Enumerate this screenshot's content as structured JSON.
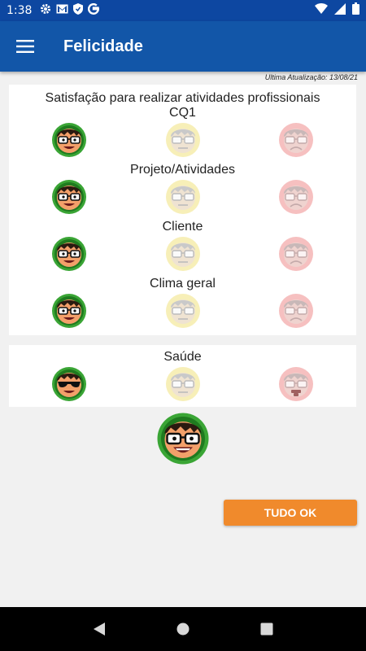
{
  "status_bar": {
    "time": "1:38",
    "icons": [
      "gear-icon",
      "gmail-icon",
      "shield-icon",
      "google-icon"
    ],
    "right_icons": [
      "wifi-icon",
      "signal-icon",
      "battery-icon"
    ]
  },
  "app_bar": {
    "title": "Felicidade",
    "menu_icon": "hamburger-menu-icon"
  },
  "last_update": "Ultima Atualização: 13/08/21",
  "work_card": {
    "heading": "Satisfação para realizar atividades profissionais",
    "rows": [
      {
        "label": "CQ1",
        "selected": "happy"
      },
      {
        "label": "Projeto/Atividades",
        "selected": "happy"
      },
      {
        "label": "Cliente",
        "selected": "happy"
      },
      {
        "label": "Clima geral",
        "selected": "happy"
      }
    ]
  },
  "health_card": {
    "rows": [
      {
        "label": "Saúde",
        "selected": "happy"
      }
    ]
  },
  "face_options": [
    "happy",
    "neutral",
    "sad"
  ],
  "colors": {
    "app_bar": "#1256a8",
    "status_bar": "#0d47a1",
    "happy_ring": "#3aa535",
    "neutral_ring": "#f7efb8",
    "sad_ring": "#f6c0c0",
    "button": "#f08a2c"
  },
  "action_button": "TUDO OK",
  "nav_bar": [
    "back-icon",
    "home-icon",
    "recents-icon"
  ]
}
